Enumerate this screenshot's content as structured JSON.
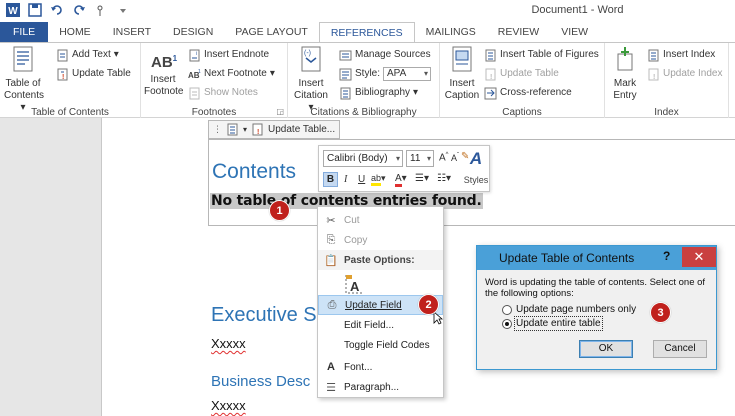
{
  "window": {
    "title": "Document1 - Word"
  },
  "tabs": [
    {
      "label": "FILE"
    },
    {
      "label": "HOME"
    },
    {
      "label": "INSERT"
    },
    {
      "label": "DESIGN"
    },
    {
      "label": "PAGE LAYOUT"
    },
    {
      "label": "REFERENCES",
      "active": true
    },
    {
      "label": "MAILINGS"
    },
    {
      "label": "REVIEW"
    },
    {
      "label": "VIEW"
    }
  ],
  "ribbon": {
    "toc_group": {
      "label": "Table of Contents",
      "toc_button": "Table of\nContents",
      "add_text": "Add Text",
      "update_table": "Update Table"
    },
    "footnotes_group": {
      "label": "Footnotes",
      "insert_footnote": "Insert\nFootnote",
      "insert_endnote": "Insert Endnote",
      "next_footnote": "Next Footnote",
      "show_notes": "Show Notes",
      "ab_glyph": "AB"
    },
    "citations_group": {
      "label": "Citations & Bibliography",
      "insert_citation": "Insert\nCitation",
      "manage_sources": "Manage Sources",
      "style_label": "Style:",
      "style_value": "APA",
      "bibliography": "Bibliography"
    },
    "captions_group": {
      "label": "Captions",
      "insert_caption": "Insert\nCaption",
      "insert_table_of_figures": "Insert Table of Figures",
      "update_table": "Update Table",
      "cross_reference": "Cross-reference"
    },
    "index_group": {
      "label": "Index",
      "mark_entry": "Mark\nEntry",
      "insert_index": "Insert Index",
      "update_index": "Update Index"
    }
  },
  "document": {
    "toc_handle_label": "Update Table...",
    "contents_heading": "Contents",
    "no_toc_message": "No table of contents entries found.",
    "heading1": "Executive S",
    "para1": "Xxxxx",
    "heading2": "Business Desc",
    "para2": "Xxxxx"
  },
  "mini_toolbar": {
    "font": "Calibri (Body)",
    "size": "11",
    "styles_label": "Styles"
  },
  "context_menu": {
    "items": [
      {
        "label": "Cut",
        "disabled": true
      },
      {
        "label": "Copy",
        "disabled": true
      },
      {
        "label": "Paste Options:"
      },
      {
        "label": "Update Field",
        "highlighted": true
      },
      {
        "label": "Edit Field..."
      },
      {
        "label": "Toggle Field Codes"
      },
      {
        "label": "Font..."
      },
      {
        "label": "Paragraph..."
      }
    ]
  },
  "dialog": {
    "title": "Update Table of Contents",
    "help": "?",
    "message": "Word is updating the table of contents.  Select one of the following options:",
    "options": [
      {
        "label": "Update page numbers only",
        "selected": false
      },
      {
        "label": "Update entire table",
        "selected": true
      }
    ],
    "ok": "OK",
    "cancel": "Cancel"
  },
  "markers": [
    "1",
    "2",
    "3"
  ],
  "colors": {
    "accent": "#2b579a",
    "heading": "#2e74b5",
    "marker": "#c0201c",
    "dialog_title": "#4aa0d8",
    "close_button": "#c94040"
  }
}
